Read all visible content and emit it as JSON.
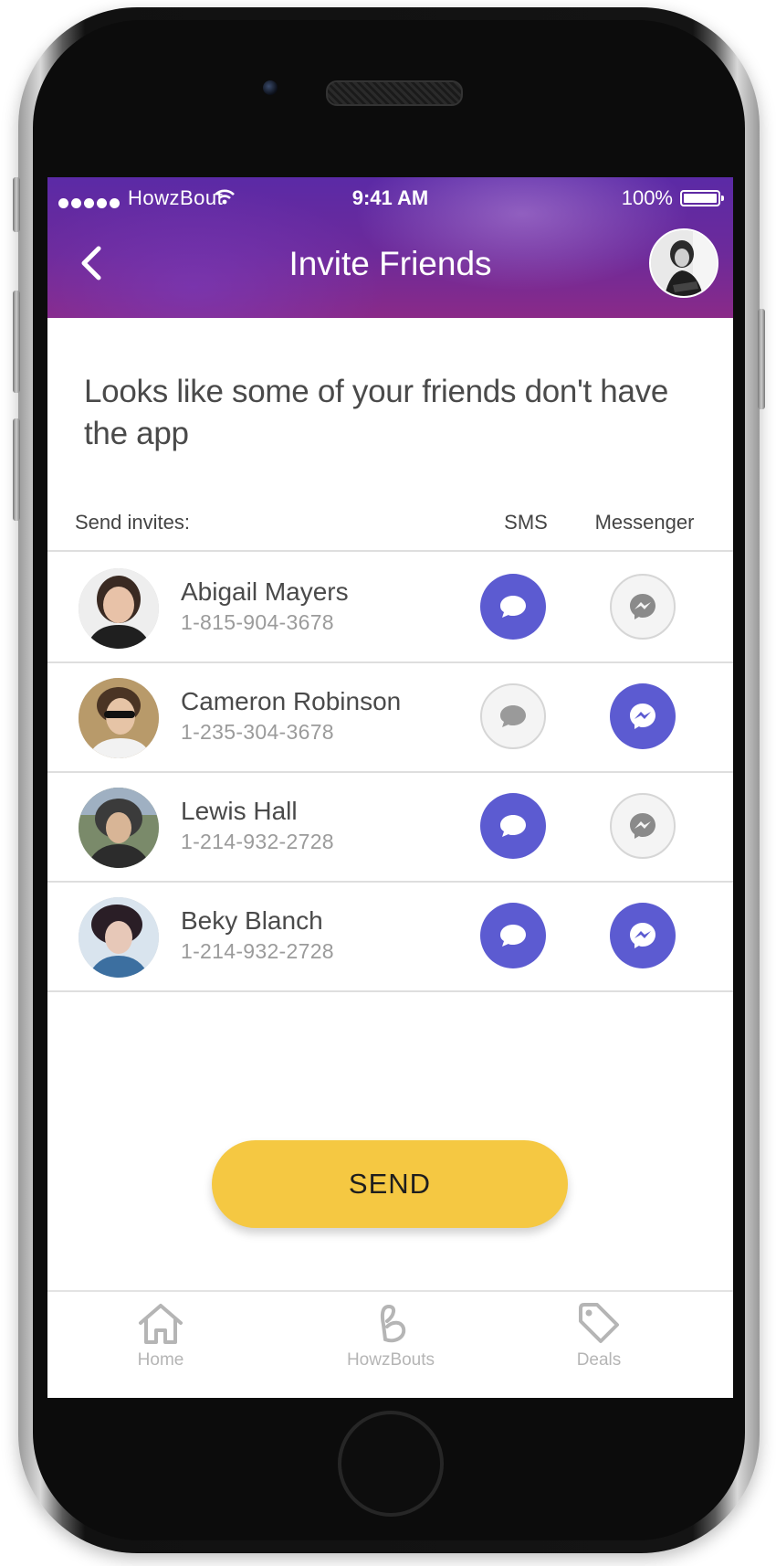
{
  "status_bar": {
    "carrier": "HowzBout",
    "time": "9:41 AM",
    "battery": "100%"
  },
  "header": {
    "title": "Invite Friends"
  },
  "intro_text": "Looks like some of your friends don't have the app",
  "table": {
    "send_label": "Send invites:",
    "sms_label": "SMS",
    "messenger_label": "Messenger"
  },
  "contacts": [
    {
      "name": "Abigail Mayers",
      "phone": "1-815-904-3678",
      "sms": true,
      "messenger": false
    },
    {
      "name": "Cameron Robinson",
      "phone": "1-235-304-3678",
      "sms": false,
      "messenger": true
    },
    {
      "name": "Lewis Hall",
      "phone": "1-214-932-2728",
      "sms": true,
      "messenger": false
    },
    {
      "name": "Beky Blanch",
      "phone": "1-214-932-2728",
      "sms": true,
      "messenger": true
    }
  ],
  "send_button": "SEND",
  "tabs": [
    {
      "label": "Home",
      "icon": "home-icon"
    },
    {
      "label": "HowzBouts",
      "icon": "howzbouts-logo-icon"
    },
    {
      "label": "Deals",
      "icon": "tag-icon"
    }
  ],
  "colors": {
    "accent": "#5c5bd1",
    "send_button": "#f5c842",
    "header_gradient_start": "#5b2aa6",
    "header_gradient_end": "#8a2a88",
    "toggle_off": "#f4f4f4",
    "tab_inactive": "#b5b5b5"
  }
}
